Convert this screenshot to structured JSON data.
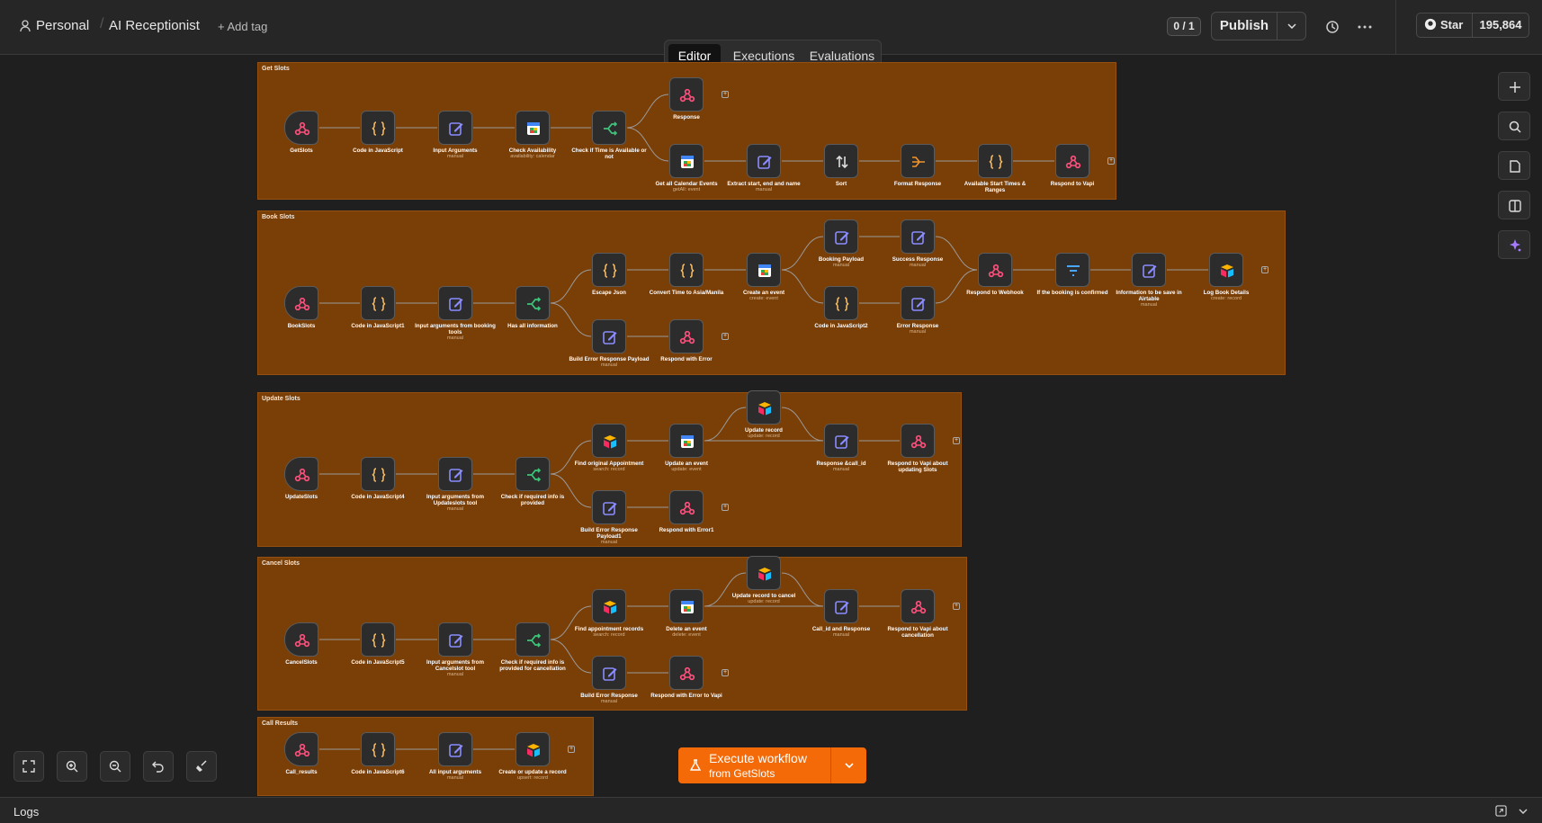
{
  "header": {
    "project": "Personal",
    "workflow_name": "AI Receptionist",
    "add_tag": "+ Add tag",
    "counter": "0 / 1",
    "publish": "Publish",
    "github_star": "Star",
    "github_count": "195,864"
  },
  "tabs": [
    {
      "label": "Editor",
      "active": true
    },
    {
      "label": "Executions",
      "active": false
    },
    {
      "label": "Evaluations",
      "active": false
    }
  ],
  "groups": [
    {
      "title": "Get Slots",
      "nodes": [
        {
          "label": "GetSlots",
          "icon": "webhook-icon",
          "trigger": true
        },
        {
          "label": "Code in JavaScript",
          "icon": "code-icon"
        },
        {
          "label": "Input Arguments",
          "sub": "manual",
          "icon": "edit-icon"
        },
        {
          "label": "Check Availability",
          "sub": "availability: calendar",
          "icon": "calendar-icon"
        },
        {
          "label": "Check if Time is Available or not",
          "icon": "if-icon"
        },
        {
          "label": "Response",
          "icon": "webhook-icon"
        },
        {
          "label": "Get all Calendar Events",
          "sub": "getAll: event",
          "icon": "calendar-icon"
        },
        {
          "label": "Extract start, end and name",
          "sub": "manual",
          "icon": "edit-icon"
        },
        {
          "label": "Sort",
          "icon": "sort-icon"
        },
        {
          "label": "Format Response",
          "icon": "merge-icon"
        },
        {
          "label": "Available Start Times & Ranges",
          "icon": "code-icon"
        },
        {
          "label": "Respond to Vapi",
          "icon": "webhook-icon"
        }
      ]
    },
    {
      "title": "Book Slots",
      "nodes": [
        {
          "label": "BookSlots",
          "icon": "webhook-icon",
          "trigger": true
        },
        {
          "label": "Code in JavaScript1",
          "icon": "code-icon"
        },
        {
          "label": "Input arguments from booking tools",
          "sub": "manual",
          "icon": "edit-icon"
        },
        {
          "label": "Has all information",
          "icon": "if-icon"
        },
        {
          "label": "Escape Json",
          "icon": "code-icon"
        },
        {
          "label": "Convert Time to Asia/Manila",
          "icon": "code-icon"
        },
        {
          "label": "Create an event",
          "sub": "create: event",
          "icon": "calendar-icon"
        },
        {
          "label": "Booking Payload",
          "sub": "manual",
          "icon": "edit-icon"
        },
        {
          "label": "Success Response",
          "sub": "manual",
          "icon": "edit-icon"
        },
        {
          "label": "Code in JavaScript2",
          "icon": "code-icon"
        },
        {
          "label": "Error Response",
          "sub": "manual",
          "icon": "edit-icon"
        },
        {
          "label": "Respond to Webhook",
          "icon": "webhook-icon"
        },
        {
          "label": "If the booking is confirmed",
          "icon": "filter-icon"
        },
        {
          "label": "Information to be save in Airtable",
          "sub": "manual",
          "icon": "edit-icon"
        },
        {
          "label": "Log Book Details",
          "sub": "create: record",
          "icon": "airtable-icon"
        },
        {
          "label": "Build Error Response Payload",
          "sub": "manual",
          "icon": "edit-icon"
        },
        {
          "label": "Respond with Error",
          "icon": "webhook-icon"
        }
      ]
    },
    {
      "title": "Update Slots",
      "nodes": [
        {
          "label": "UpdateSlots",
          "icon": "webhook-icon",
          "trigger": true
        },
        {
          "label": "Code in JavaScript4",
          "icon": "code-icon"
        },
        {
          "label": "Input arguments from Updateslots tool",
          "sub": "manual",
          "icon": "edit-icon"
        },
        {
          "label": "Check if required info is provided",
          "icon": "if-icon"
        },
        {
          "label": "Find original Appointment",
          "sub": "search: record",
          "icon": "airtable-icon"
        },
        {
          "label": "Update an event",
          "sub": "update: event",
          "icon": "calendar-icon"
        },
        {
          "label": "Update record",
          "sub": "update: record",
          "icon": "airtable-icon"
        },
        {
          "label": "Response &call_id",
          "sub": "manual",
          "icon": "edit-icon"
        },
        {
          "label": "Respond to Vapi about updating Slots",
          "icon": "webhook-icon"
        },
        {
          "label": "Build Error Response Payload1",
          "sub": "manual",
          "icon": "edit-icon"
        },
        {
          "label": "Respond with Error1",
          "icon": "webhook-icon"
        }
      ]
    },
    {
      "title": "Cancel Slots",
      "nodes": [
        {
          "label": "CancelSlots",
          "icon": "webhook-icon",
          "trigger": true
        },
        {
          "label": "Code in JavaScript5",
          "icon": "code-icon"
        },
        {
          "label": "Input arguments from Cancelslot tool",
          "sub": "manual",
          "icon": "edit-icon"
        },
        {
          "label": "Check if required info is provided for cancellation",
          "icon": "if-icon"
        },
        {
          "label": "Find appointment records",
          "sub": "search: record",
          "icon": "airtable-icon"
        },
        {
          "label": "Delete an event",
          "sub": "delete: event",
          "icon": "calendar-icon"
        },
        {
          "label": "Update record to cancel",
          "sub": "update: record",
          "icon": "airtable-icon"
        },
        {
          "label": "Call_id and Response",
          "sub": "manual",
          "icon": "edit-icon"
        },
        {
          "label": "Respond to Vapi about cancellation",
          "icon": "webhook-icon"
        },
        {
          "label": "Build Error Response",
          "sub": "manual",
          "icon": "edit-icon"
        },
        {
          "label": "Respond with Error to Vapi",
          "icon": "webhook-icon"
        }
      ]
    },
    {
      "title": "Call Results",
      "nodes": [
        {
          "label": "Call_results",
          "icon": "webhook-icon",
          "trigger": true
        },
        {
          "label": "Code in JavaScript6",
          "icon": "code-icon"
        },
        {
          "label": "All input arguments",
          "sub": "manual",
          "icon": "edit-icon"
        },
        {
          "label": "Create or update a record",
          "sub": "upsert: record",
          "icon": "airtable-icon"
        }
      ]
    }
  ],
  "execute": {
    "title": "Execute workflow",
    "subtitle": "from GetSlots"
  },
  "logs": {
    "label": "Logs"
  },
  "colors": {
    "group_bg": "#7a3e07",
    "accent": "#f46a08",
    "node_bg": "#2c2c2c",
    "canvas": "#1f1f1f"
  }
}
